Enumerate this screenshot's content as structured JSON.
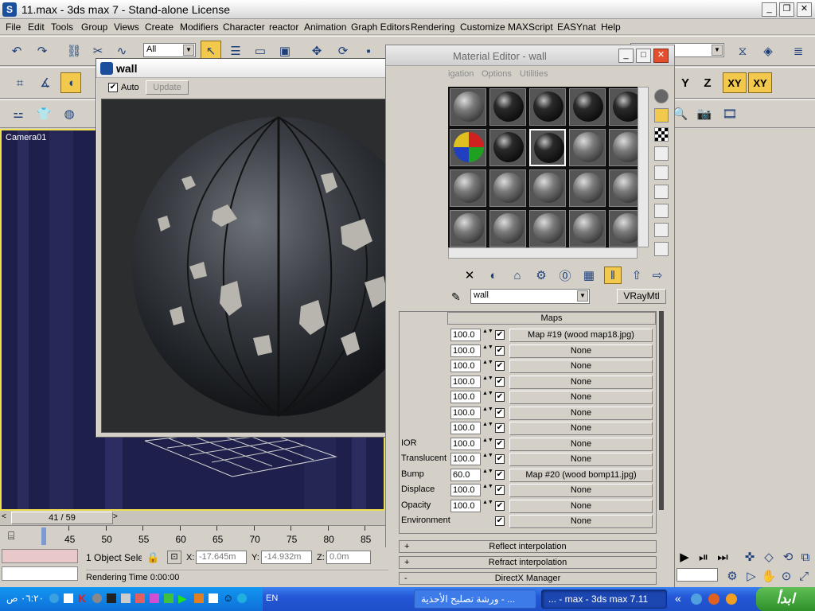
{
  "window": {
    "title": "11.max - 3ds max 7  - Stand-alone License",
    "app_icon": "3ds-max-icon"
  },
  "menu": [
    "File",
    "Edit",
    "Tools",
    "Group",
    "Views",
    "Create",
    "Modifiers",
    "Character",
    "reactor",
    "Animation",
    "Graph Editors",
    "Rendering",
    "Customize",
    "MAXScript",
    "EASYnat",
    "Help"
  ],
  "toolbar": {
    "selection_filter": "All",
    "axis_labels": [
      "Y",
      "Z",
      "XY",
      "XY"
    ]
  },
  "viewport": {
    "label": "Camera01"
  },
  "render_window": {
    "title": "wall",
    "auto_label": "Auto",
    "auto_checked": true,
    "update_label": "Update"
  },
  "material_editor": {
    "title": "Material Editor - wall",
    "menu_partial": [
      "igation",
      "Options",
      "Utilities"
    ],
    "material_name": "wall",
    "material_type": "VRayMtl",
    "maps_header": "Maps",
    "maps": [
      {
        "label": "",
        "amount": "100.0",
        "checked": true,
        "map": "Map #19 (wood map18.jpg)"
      },
      {
        "label": "",
        "amount": "100.0",
        "checked": true,
        "map": "None"
      },
      {
        "label": "",
        "amount": "100.0",
        "checked": true,
        "map": "None"
      },
      {
        "label": "",
        "amount": "100.0",
        "checked": true,
        "map": "None"
      },
      {
        "label": "",
        "amount": "100.0",
        "checked": true,
        "map": "None"
      },
      {
        "label": "",
        "amount": "100.0",
        "checked": true,
        "map": "None"
      },
      {
        "label": "",
        "amount": "100.0",
        "checked": true,
        "map": "None"
      },
      {
        "label": "IOR",
        "amount": "100.0",
        "checked": true,
        "map": "None"
      },
      {
        "label": "Translucent",
        "amount": "100.0",
        "checked": true,
        "map": "None"
      },
      {
        "label": "Bump",
        "amount": "60.0",
        "checked": true,
        "map": "Map #20 (wood bomp11.jpg)"
      },
      {
        "label": "Displace",
        "amount": "100.0",
        "checked": true,
        "map": "None"
      },
      {
        "label": "Opacity",
        "amount": "100.0",
        "checked": true,
        "map": "None"
      },
      {
        "label": "Environment",
        "amount": "",
        "checked": true,
        "map": "None"
      }
    ],
    "rollouts": [
      {
        "sign": "+",
        "label": "Reflect interpolation"
      },
      {
        "sign": "+",
        "label": "Refract interpolation"
      },
      {
        "sign": "-",
        "label": "DirectX Manager"
      }
    ]
  },
  "timeline": {
    "frame": "41 / 59",
    "ticks": [
      "45",
      "50",
      "55",
      "60",
      "65",
      "70",
      "75",
      "80",
      "85"
    ]
  },
  "status": {
    "selection": "1 Object Sele",
    "x_label": "X:",
    "x": "-17.645m",
    "y_label": "Y:",
    "y": "-14.932m",
    "z_label": "Z:",
    "z": "0.0m",
    "render_time": "Rendering Time  0:00:00"
  },
  "taskbar": {
    "start": "ابدأ",
    "clock": "٠٦:٢٠ ص",
    "lang": "EN",
    "tasks": [
      "... - max - 3ds max 7.11",
      "ورشة تصليح الأحذية - ..."
    ]
  }
}
